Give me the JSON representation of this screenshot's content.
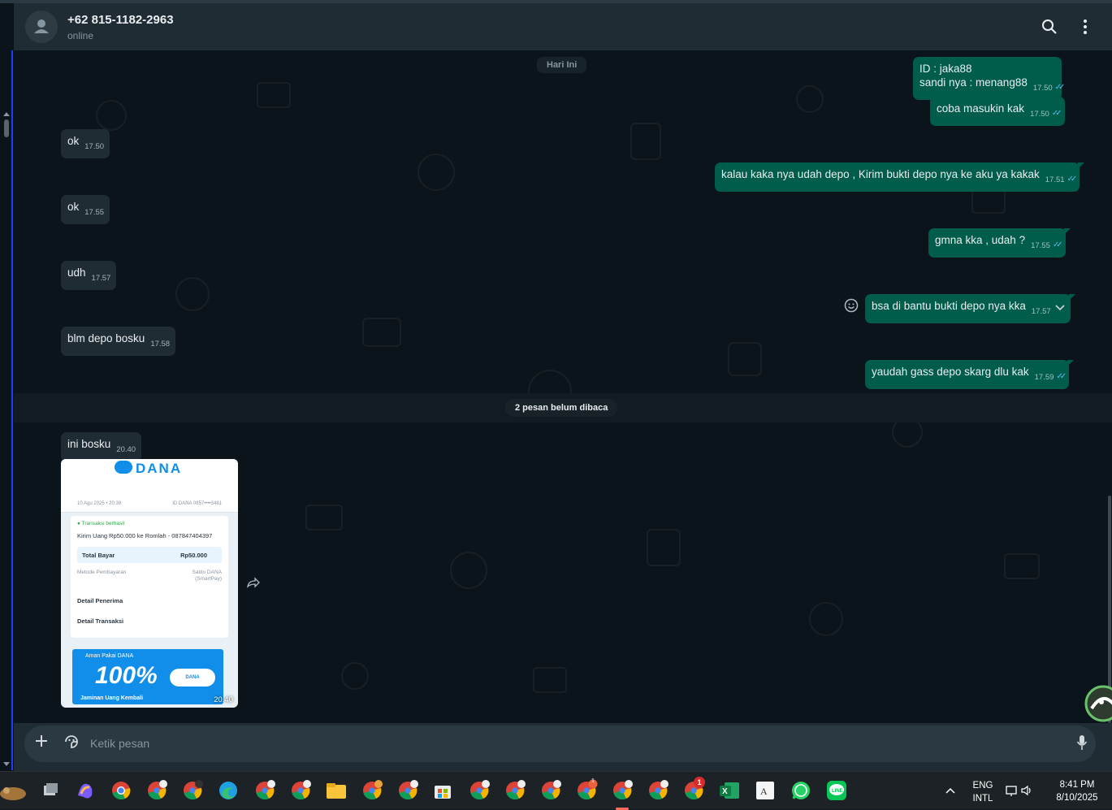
{
  "header": {
    "contact_name": "+62 815-1182-2963",
    "status": "online",
    "search_icon": "search-icon",
    "menu_icon": "more-vert-icon"
  },
  "chat": {
    "day_divider": "Hari Ini",
    "unread_divider": "2 pesan belum dibaca",
    "messages": [
      {
        "dir": "out",
        "lines": [
          "ID : jaka88",
          "sandi nya : menang88"
        ],
        "time": "17.50",
        "status": "read"
      },
      {
        "dir": "out",
        "text": "coba masukin kak",
        "time": "17.50",
        "status": "read"
      },
      {
        "dir": "in",
        "text": "ok",
        "time": "17.50"
      },
      {
        "dir": "out",
        "text": "kalau kaka nya udah depo , Kirim bukti depo nya ke aku ya kakak",
        "time": "17.51",
        "status": "read"
      },
      {
        "dir": "in",
        "text": "ok",
        "time": "17.55"
      },
      {
        "dir": "out",
        "text": "gmna kka , udah ?",
        "time": "17.55",
        "status": "read"
      },
      {
        "dir": "in",
        "text": "udh",
        "time": "17.57"
      },
      {
        "dir": "out",
        "text": "bsa di bantu bukti depo nya kka",
        "time": "17.57",
        "status": "menu"
      },
      {
        "dir": "in",
        "text": "blm depo bosku",
        "time": "17.58"
      },
      {
        "dir": "out",
        "text": "yaudah gass depo skarg dlu kak",
        "time": "17.59",
        "status": "read"
      },
      {
        "dir": "in",
        "text": "ini bosku",
        "time": "20.40"
      }
    ],
    "image_message": {
      "time": "20.40",
      "brand": "DANA",
      "date_text": "10 Agu 2025 • 20:39",
      "id_text": "ID DANA 0857••••3481",
      "status_text": "Transaksi berhasil",
      "transfer_text": "Kirim Uang Rp50.000 ke Romlah - 087847404397",
      "total_label": "Total Bayar",
      "total_value": "Rp50.000",
      "method_label": "Metode Pembayaran",
      "method_value_1": "Saldo DANA",
      "method_value_2": "(SmartPay)",
      "detail_penerima": "Detail Penerima",
      "detail_transaksi": "Detail Transaksi",
      "banner_top": "Aman Pakai DANA",
      "banner_big": "100%",
      "banner_foot": "Jaminan Uang Kembali",
      "banner_badge": "DANA PROTECTION"
    }
  },
  "composer": {
    "placeholder": "Ketik pesan",
    "attach_icon": "plus-icon",
    "emoji_icon": "sticker-icon",
    "mic_icon": "mic-icon"
  },
  "taskbar": {
    "language_line1": "ENG",
    "language_line2": "INTL",
    "time": "8:41 PM",
    "date": "8/10/2025",
    "badge_count": "1",
    "chrome_badge": "1"
  },
  "colors": {
    "chat_bg": "#0b141a",
    "header_bg": "#202c33",
    "outgoing_bubble": "#005c4b",
    "incoming_bubble": "#202c33",
    "read_tick": "#53bdeb",
    "dana_blue": "#118eea"
  }
}
